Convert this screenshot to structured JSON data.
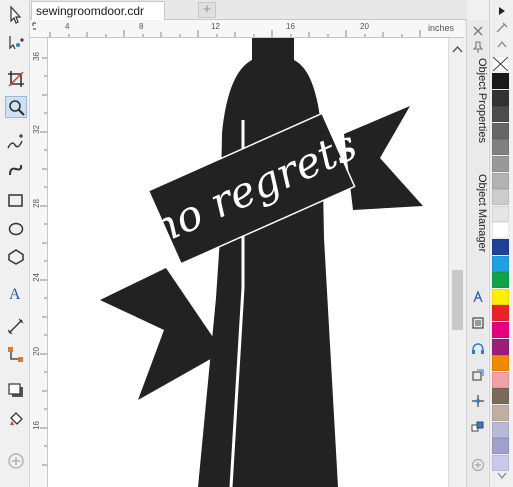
{
  "document": {
    "tab_label": "sewingroomdoor.cdr",
    "new_tab_label": "+"
  },
  "ruler": {
    "units_label": "inches",
    "horizontal_labels": [
      "4",
      "8",
      "12",
      "16",
      "20"
    ],
    "vertical_labels": [
      "36",
      "32",
      "28",
      "24",
      "20",
      "16"
    ]
  },
  "artwork": {
    "banner_text": "no regrets",
    "silhouette_color": "#222222",
    "text_color": "#ffffff"
  },
  "dockers": {
    "object_properties": "Object Properties",
    "object_manager": "Object Manager"
  },
  "toolbox": {
    "tools": [
      "pick-tool-icon",
      "shape-tool-icon",
      "crop-tool-icon",
      "zoom-tool-icon",
      "freehand-tool-icon",
      "artistic-media-icon",
      "rectangle-tool-icon",
      "ellipse-tool-icon",
      "polygon-tool-icon",
      "text-tool-icon",
      "dimension-tool-icon",
      "connector-tool-icon",
      "drop-shadow-icon",
      "interactive-fill-icon",
      "add-tool-icon"
    ]
  },
  "palette": {
    "colors": [
      "#1a1a1a",
      "#333333",
      "#4d4d4d",
      "#666666",
      "#808080",
      "#999999",
      "#b3b3b3",
      "#cccccc",
      "#e6e6e6",
      "#ffffff",
      "#1f3f99",
      "#1fa0e0",
      "#11a34a",
      "#ffee00",
      "#e8232a",
      "#e6007e",
      "#9b1f7a",
      "#f18a00",
      "#f3a0a8",
      "#7a6a5a",
      "#c0b0a0",
      "#b8b8d8",
      "#9ea0d0",
      "#c8c8e8"
    ]
  }
}
